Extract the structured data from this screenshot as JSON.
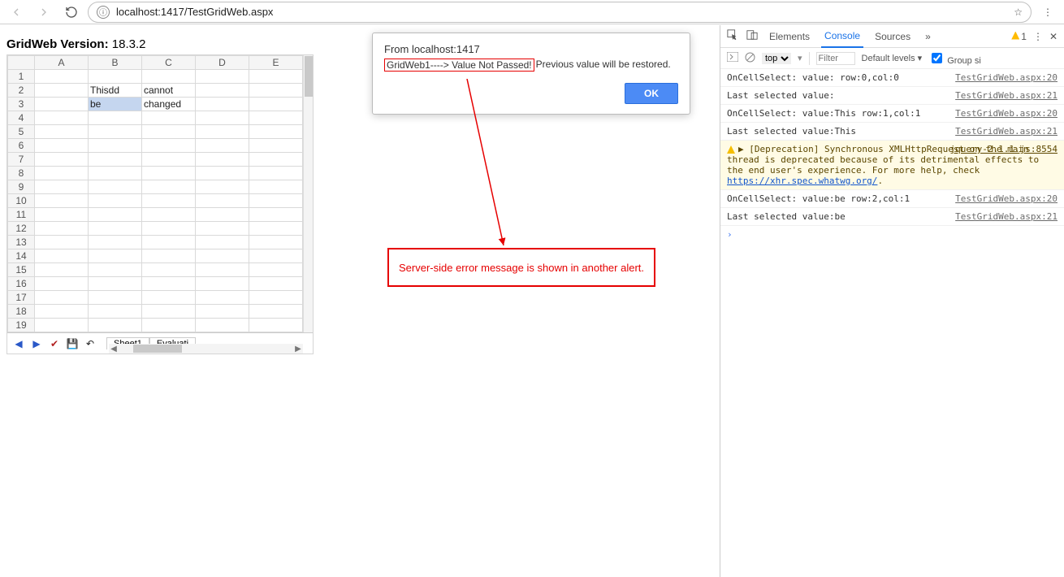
{
  "colors": {
    "accent": "#4c8bf5",
    "danger": "#e60000",
    "warnbg": "#fffbe5"
  },
  "chrome": {
    "url": "localhost:1417/TestGridWeb.aspx"
  },
  "page": {
    "title_prefix": "GridWeb Version:",
    "version": "18.3.2",
    "columns": [
      "A",
      "B",
      "C",
      "D",
      "E"
    ],
    "rows": [
      1,
      2,
      3,
      4,
      5,
      6,
      7,
      8,
      9,
      10,
      11,
      12,
      13,
      14,
      15,
      16,
      17,
      18,
      19
    ],
    "cells": {
      "B2": "Thisdd",
      "C2": "cannot",
      "B3": "be",
      "C3": "changed"
    },
    "selected_cell": "B3",
    "sheet_tabs": [
      "Sheet1",
      "Evaluati"
    ]
  },
  "alert": {
    "title": "From localhost:1417",
    "highlight": "GridWeb1----> Value Not Passed!",
    "rest": "Previous value will be restored.",
    "ok": "OK"
  },
  "annotation": {
    "text": "Server-side error message is shown in another alert."
  },
  "devtools": {
    "tabs": [
      "Elements",
      "Console",
      "Sources"
    ],
    "active_tab": "Console",
    "warn_count": "1",
    "context": "top",
    "filter_placeholder": "Filter",
    "levels": "Default levels ▾",
    "group_label": "Group si",
    "logs": [
      {
        "kind": "log",
        "text": "OnCellSelect: value: row:0,col:0",
        "src": "TestGridWeb.aspx:20"
      },
      {
        "kind": "log",
        "text": "Last selected value:",
        "src": "TestGridWeb.aspx:21"
      },
      {
        "kind": "log",
        "text": "OnCellSelect: value:This row:1,col:1",
        "src": "TestGridWeb.aspx:20"
      },
      {
        "kind": "log",
        "text": "Last selected value:This",
        "src": "TestGridWeb.aspx:21"
      },
      {
        "kind": "warn",
        "text": "▶ [Deprecation] Synchronous XMLHttpRequest on the main thread is deprecated because of its detrimental effects to the end user's experience. For more help, check ",
        "link": "https://xhr.spec.whatwg.org/",
        "wsrc": "jquery-2.1.1.js:8554"
      },
      {
        "kind": "log",
        "text": "OnCellSelect: value:be row:2,col:1",
        "src": "TestGridWeb.aspx:20"
      },
      {
        "kind": "log",
        "text": "Last selected value:be",
        "src": "TestGridWeb.aspx:21"
      }
    ]
  }
}
